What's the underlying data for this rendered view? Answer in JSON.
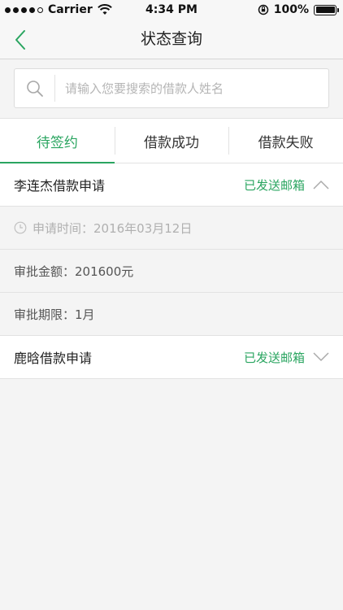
{
  "status_bar": {
    "carrier": "Carrier",
    "time": "4:34 PM",
    "battery": "100%",
    "battery_level": 1.0
  },
  "nav": {
    "title": "状态查询",
    "back_icon": "chevron-left-icon"
  },
  "search": {
    "placeholder": "请输入您要搜索的借款人姓名",
    "value": ""
  },
  "tabs": [
    {
      "label": "待签约",
      "active": true
    },
    {
      "label": "借款成功",
      "active": false
    },
    {
      "label": "借款失败",
      "active": false
    }
  ],
  "applications": [
    {
      "title": "李连杰借款申请",
      "status": "已发送邮箱",
      "expanded": true,
      "details": {
        "apply_time": "申请时间：2016年03月12日",
        "amount": "审批金额：201600元",
        "term": "审批期限：1月"
      }
    },
    {
      "title": "鹿晗借款申请",
      "status": "已发送邮箱",
      "expanded": false
    }
  ],
  "colors": {
    "accent": "#2aa560",
    "background": "#f4f4f4",
    "divider": "#e2e2e2"
  }
}
